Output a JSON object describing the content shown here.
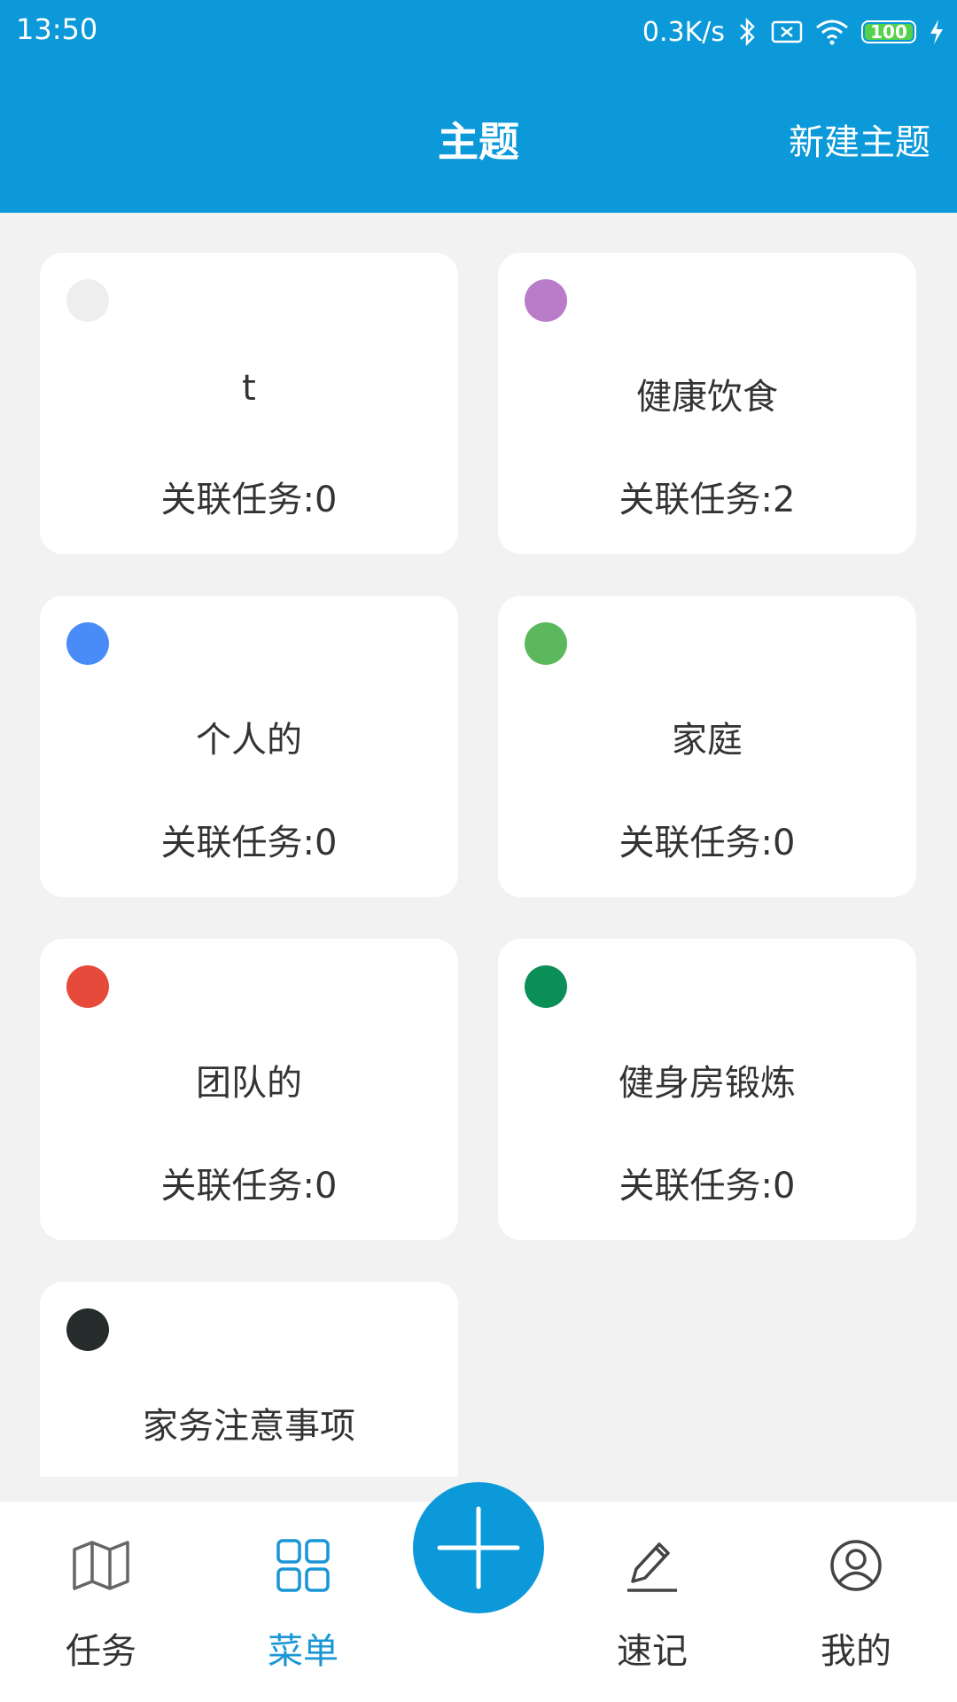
{
  "status_bar": {
    "time": "13:50",
    "speed": "0.3K/s",
    "battery": "100",
    "icons": [
      "bluetooth-icon",
      "sim-off-icon",
      "wifi-icon",
      "battery-icon",
      "charging-icon"
    ]
  },
  "app_bar": {
    "title": "主题",
    "action": "新建主题"
  },
  "topics": [
    {
      "name": "t",
      "count_label": "关联任务:0",
      "color": "#eeeeee"
    },
    {
      "name": "健康饮食",
      "count_label": "关联任务:2",
      "color": "#b97cc9"
    },
    {
      "name": "个人的",
      "count_label": "关联任务:0",
      "color": "#4a8cf7"
    },
    {
      "name": "家庭",
      "count_label": "关联任务:0",
      "color": "#5cb85c"
    },
    {
      "name": "团队的",
      "count_label": "关联任务:0",
      "color": "#e64a3b"
    },
    {
      "name": "健身房锻炼",
      "count_label": "关联任务:0",
      "color": "#0a8f57"
    },
    {
      "name": "家务注意事项",
      "count_label": "",
      "color": "#262c2c"
    }
  ],
  "bottom_nav": {
    "items": [
      {
        "label": "任务",
        "icon": "map-icon",
        "active": false
      },
      {
        "label": "菜单",
        "icon": "grid-icon",
        "active": true
      },
      {
        "label": "速记",
        "icon": "pen-icon",
        "active": false
      },
      {
        "label": "我的",
        "icon": "user-icon",
        "active": false
      }
    ],
    "fab_icon": "plus-icon"
  },
  "colors": {
    "primary": "#0b99d9",
    "active_nav": "#1a96d6",
    "background": "#f2f2f2"
  }
}
